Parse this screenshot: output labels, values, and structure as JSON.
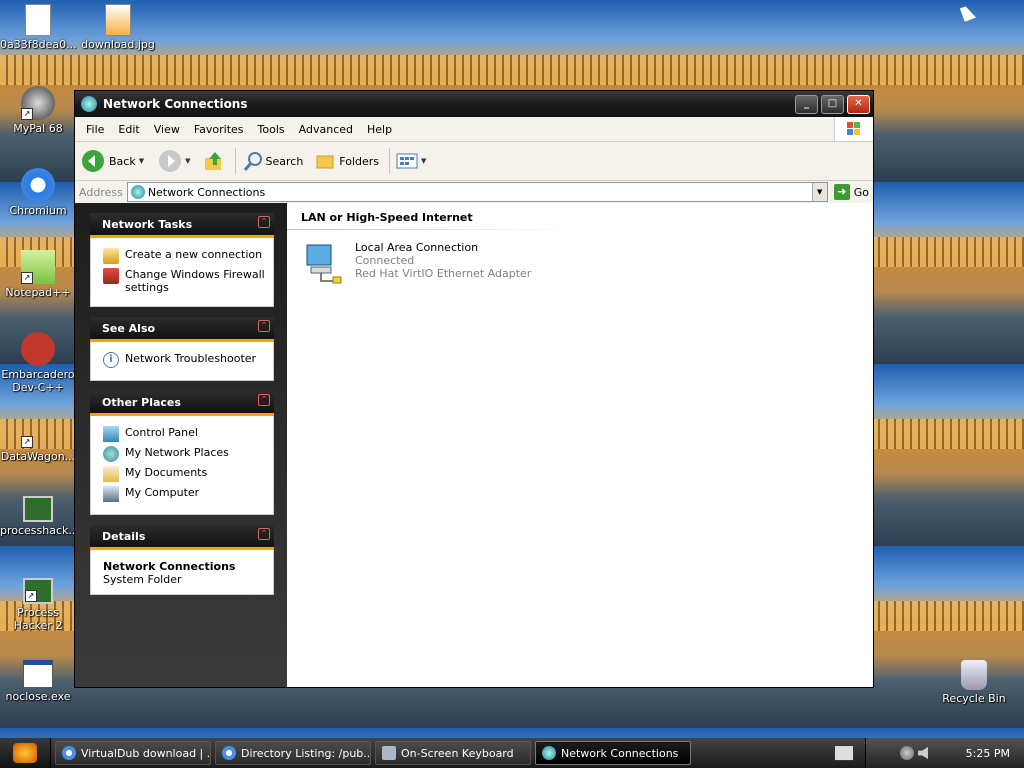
{
  "desktop": {
    "icons": [
      {
        "label": "0a33f8dea0..."
      },
      {
        "label": "download.jpg"
      },
      {
        "label": "MyPal 68"
      },
      {
        "label": "Chromium"
      },
      {
        "label": "Notepad++"
      },
      {
        "label": "Embarcadero Dev-C++"
      },
      {
        "label": "DataWagon..."
      },
      {
        "label": "processhack..."
      },
      {
        "label": "Process Hacker 2"
      },
      {
        "label": "noclose.exe"
      },
      {
        "label": "Recycle Bin"
      }
    ]
  },
  "window": {
    "title": "Network Connections",
    "menu": [
      "File",
      "Edit",
      "View",
      "Favorites",
      "Tools",
      "Advanced",
      "Help"
    ],
    "toolbar": {
      "back": "Back",
      "search": "Search",
      "folders": "Folders"
    },
    "address": {
      "label": "Address",
      "value": "Network Connections",
      "go": "Go"
    },
    "tasks": {
      "network_tasks": {
        "title": "Network Tasks",
        "items": [
          "Create a new connection",
          "Change Windows Firewall settings"
        ]
      },
      "see_also": {
        "title": "See Also",
        "items": [
          "Network Troubleshooter"
        ]
      },
      "other_places": {
        "title": "Other Places",
        "items": [
          "Control Panel",
          "My Network Places",
          "My Documents",
          "My Computer"
        ]
      },
      "details": {
        "title": "Details",
        "name": "Network Connections",
        "type": "System Folder"
      }
    },
    "group_header": "LAN or High-Speed Internet",
    "connection": {
      "name": "Local Area Connection",
      "status": "Connected",
      "adapter": "Red Hat VirtIO Ethernet Adapter"
    }
  },
  "taskbar": {
    "tasks": [
      "VirtualDub download | ...",
      "Directory Listing: /pub...",
      "On-Screen Keyboard",
      "Network Connections"
    ],
    "clock": "5:25 PM"
  }
}
